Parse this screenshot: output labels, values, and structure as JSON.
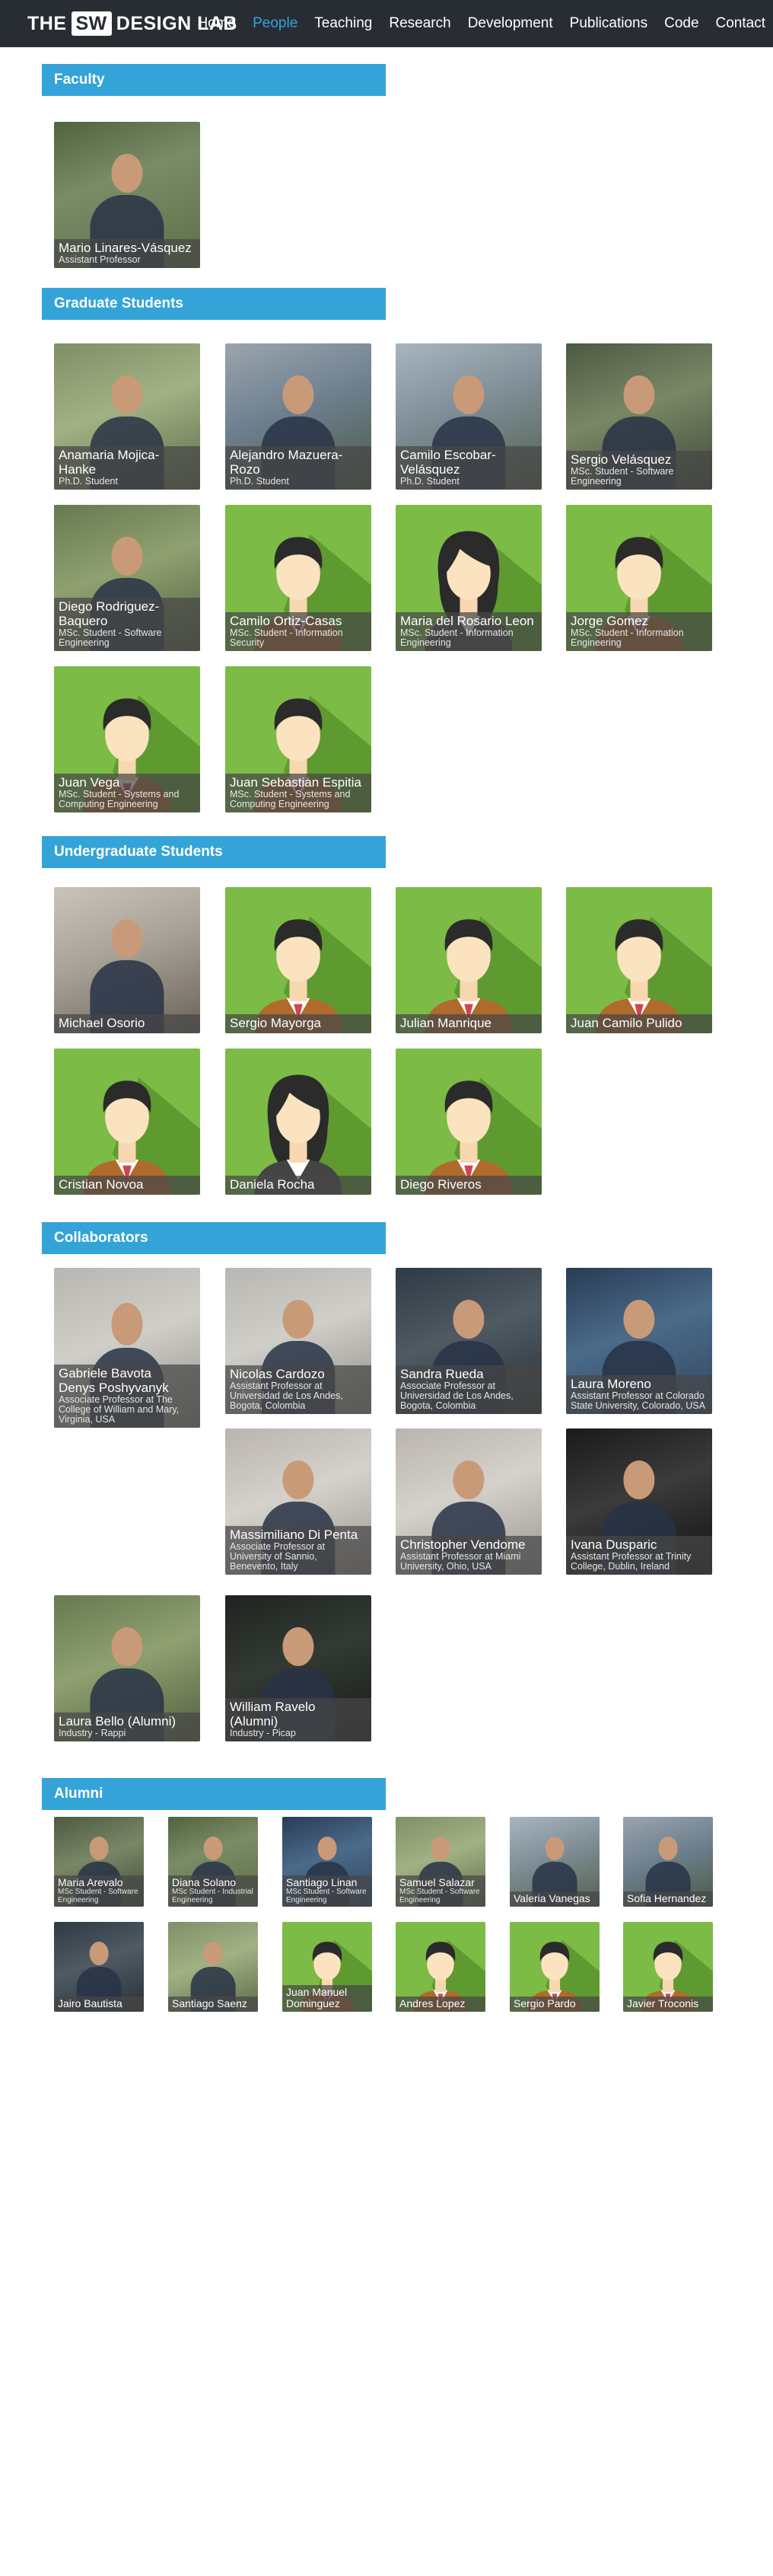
{
  "header": {
    "logo": {
      "pre": "THE",
      "boxed": "SW",
      "post": "DESIGN LAB"
    },
    "nav": [
      {
        "label": "Home",
        "active": false
      },
      {
        "label": "People",
        "active": true
      },
      {
        "label": "Teaching",
        "active": false
      },
      {
        "label": "Research",
        "active": false
      },
      {
        "label": "Development",
        "active": false
      },
      {
        "label": "Publications",
        "active": false
      },
      {
        "label": "Code",
        "active": false
      },
      {
        "label": "Contact",
        "active": false
      }
    ]
  },
  "colors": {
    "accent": "#33a3d8",
    "nav_bg": "#282d33",
    "avatar_green": "#7cbb45"
  },
  "sections": {
    "faculty": "Faculty",
    "graduate": "Graduate Students",
    "undergraduate": "Undergraduate Students",
    "collaborators": "Collaborators",
    "alumni": "Alumni"
  },
  "faculty": [
    {
      "name": "Mario Linares-Vásquez",
      "role": "Assistant Professor"
    }
  ],
  "graduate": [
    {
      "name": "Anamaria Mojica-Hanke",
      "role": "Ph.D. Student"
    },
    {
      "name": "Alejandro Mazuera-Rozo",
      "role": "Ph.D. Student"
    },
    {
      "name": "Camilo Escobar-Velásquez",
      "role": "Ph.D. Student"
    },
    {
      "name": "Sergio Velásquez",
      "role": "MSc. Student - Software Engineering"
    },
    {
      "name": "Diego Rodriguez-Baquero",
      "role": "MSc. Student - Software Engineering"
    },
    {
      "name": "Camilo Ortiz-Casas",
      "role": "MSc. Student - Information Security"
    },
    {
      "name": "Maria del Rosario Leon",
      "role": "MSc. Student - Information Engineering"
    },
    {
      "name": "Jorge Gomez",
      "role": "MSc. Student - Information Engineering"
    },
    {
      "name": "Juan Vega",
      "role": "MSc. Student - Systems and Computing Engineering"
    },
    {
      "name": "Juan Sebastian Espitia",
      "role": "MSc. Student - Systems and Computing Engineering"
    }
  ],
  "undergraduate": [
    {
      "name": "Michael Osorio"
    },
    {
      "name": "Sergio Mayorga"
    },
    {
      "name": "Julian Manrique"
    },
    {
      "name": "Juan Camilo Pulido"
    },
    {
      "name": "Cristian Novoa"
    },
    {
      "name": "Daniela Rocha"
    },
    {
      "name": "Diego Riveros"
    }
  ],
  "collaborators": [
    {
      "name": "Gabriele Bavota",
      "role": ""
    },
    {
      "name": "Denys Poshyvanyk",
      "role": "Associate Professor at The College of William and Mary, Virginia, USA"
    },
    {
      "name": "Nicolas Cardozo",
      "role": "Assistant Professor at Universidad de Los Andes, Bogota, Colombia"
    },
    {
      "name": "Sandra Rueda",
      "role": "Associate Professor at Universidad de Los Andes, Bogota, Colombia"
    },
    {
      "name": "Laura Moreno",
      "role": "Assistant Professor at Colorado State University, Colorado, USA"
    },
    {
      "name": "Massimiliano Di Penta",
      "role": "Associate Professor at University of Sannio, Benevento, Italy"
    },
    {
      "name": "Christopher Vendome",
      "role": "Assistant Professor at Miami University, Ohio, USA"
    },
    {
      "name": "Ivana Dusparic",
      "role": "Assistant Professor at Trinity College, Dublin, Ireland"
    },
    {
      "name": "Laura Bello (Alumni)",
      "role": "Industry - Rappi"
    },
    {
      "name": "William Ravelo (Alumni)",
      "role": "Industry - Picap"
    }
  ],
  "alumni": [
    {
      "name": "Maria Arevalo",
      "role": "MSc Student - Software Engineering"
    },
    {
      "name": "Diana Solano",
      "role": "MSc Student - Industrial Engineering"
    },
    {
      "name": "Santiago Linan",
      "role": "MSc Student - Software Engineering"
    },
    {
      "name": "Samuel Salazar",
      "role": "MSc Student - Software Engineering"
    },
    {
      "name": "Valeria Vanegas",
      "role": ""
    },
    {
      "name": "Sofia Hernandez",
      "role": ""
    },
    {
      "name": "Jairo Bautista",
      "role": ""
    },
    {
      "name": "Santiago Saenz",
      "role": ""
    },
    {
      "name": "Juan Manuel Dominguez",
      "role": ""
    },
    {
      "name": "Andres Lopez",
      "role": ""
    },
    {
      "name": "Sergio Pardo",
      "role": ""
    },
    {
      "name": "Javier Troconis",
      "role": ""
    }
  ]
}
